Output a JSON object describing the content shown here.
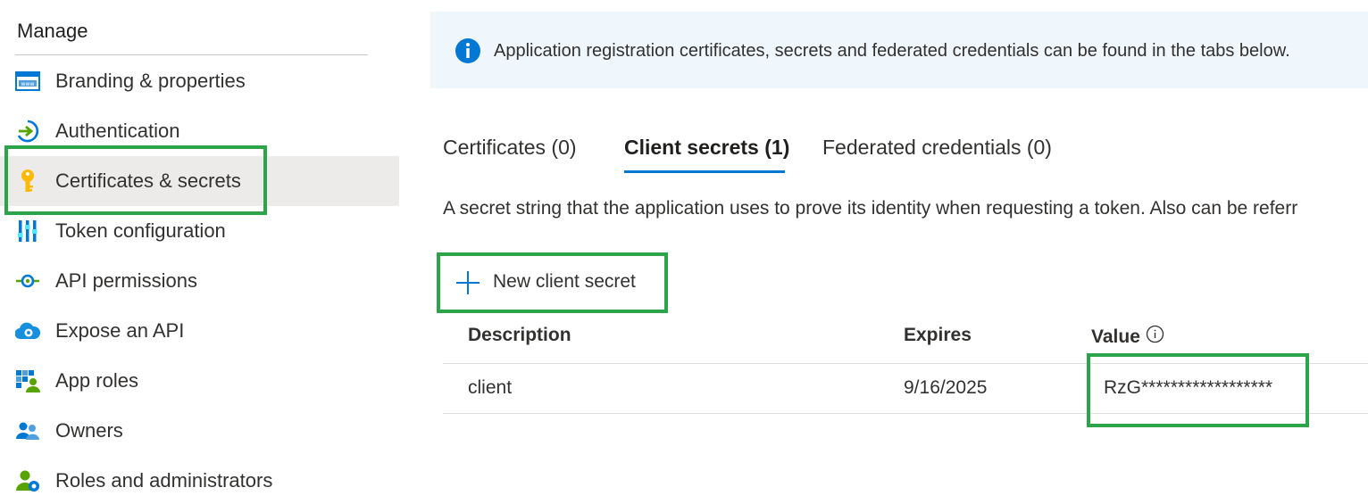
{
  "sidebar": {
    "section_title": "Manage",
    "items": [
      {
        "label": "Branding & properties",
        "icon": "branding-icon",
        "active": false
      },
      {
        "label": "Authentication",
        "icon": "authentication-icon",
        "active": false
      },
      {
        "label": "Certificates & secrets",
        "icon": "key-icon",
        "active": true
      },
      {
        "label": "Token configuration",
        "icon": "token-configuration-icon",
        "active": false
      },
      {
        "label": "API permissions",
        "icon": "api-permissions-icon",
        "active": false
      },
      {
        "label": "Expose an API",
        "icon": "cloud-gear-icon",
        "active": false
      },
      {
        "label": "App roles",
        "icon": "app-roles-icon",
        "active": false
      },
      {
        "label": "Owners",
        "icon": "owners-icon",
        "active": false
      },
      {
        "label": "Roles and administrators",
        "icon": "roles-admin-icon",
        "active": false
      }
    ]
  },
  "banner": {
    "icon": "info-icon",
    "text": "Application registration certificates, secrets and federated credentials can be found in the tabs below."
  },
  "tabs": [
    {
      "label": "Certificates (0)",
      "active": false
    },
    {
      "label": "Client secrets (1)",
      "active": true
    },
    {
      "label": "Federated credentials (0)",
      "active": false
    }
  ],
  "description": "A secret string that the application uses to prove its identity when requesting a token. Also can be referr",
  "toolbar": {
    "new_secret_label": "New client secret"
  },
  "table": {
    "columns": {
      "description": "Description",
      "expires": "Expires",
      "value": "Value"
    },
    "rows": [
      {
        "description": "client",
        "expires": "9/16/2025",
        "value": "RzG******************"
      }
    ]
  },
  "colors": {
    "accent": "#0078d4",
    "highlight": "#2ca44a",
    "active_bg": "#edebe9",
    "banner_bg": "#eff6fc"
  }
}
